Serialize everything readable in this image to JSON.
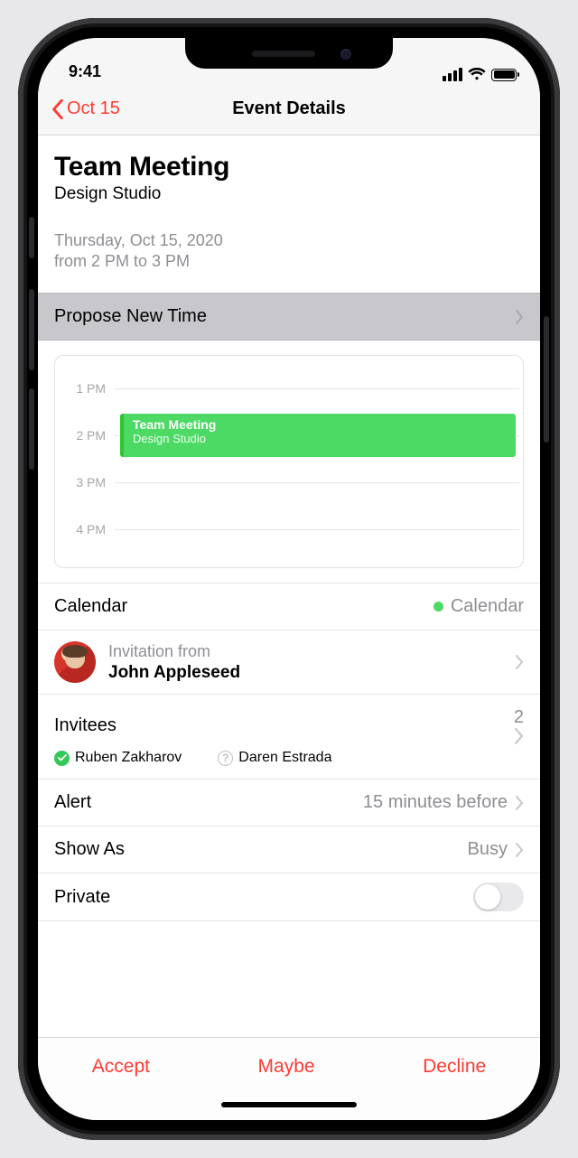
{
  "status": {
    "time": "9:41"
  },
  "nav": {
    "back_label": "Oct 15",
    "title": "Event Details"
  },
  "event": {
    "title": "Team Meeting",
    "location": "Design Studio",
    "date_line": "Thursday, Oct 15, 2020",
    "time_line": "from 2 PM to 3 PM"
  },
  "propose": {
    "label": "Propose New Time"
  },
  "timeline": {
    "hours": [
      "1 PM",
      "2 PM",
      "3 PM",
      "4 PM"
    ],
    "block_title": "Team Meeting",
    "block_location": "Design Studio"
  },
  "calendar_row": {
    "label": "Calendar",
    "value": "Calendar"
  },
  "invitation": {
    "from_label": "Invitation from",
    "name": "John Appleseed"
  },
  "invitees": {
    "label": "Invitees",
    "count": "2",
    "people": [
      {
        "name": "Ruben Zakharov",
        "status": "accepted"
      },
      {
        "name": "Daren Estrada",
        "status": "unknown"
      }
    ]
  },
  "alert_row": {
    "label": "Alert",
    "value": "15 minutes before"
  },
  "showas_row": {
    "label": "Show As",
    "value": "Busy"
  },
  "private_row": {
    "label": "Private",
    "on": false
  },
  "actions": {
    "accept": "Accept",
    "maybe": "Maybe",
    "decline": "Decline"
  }
}
